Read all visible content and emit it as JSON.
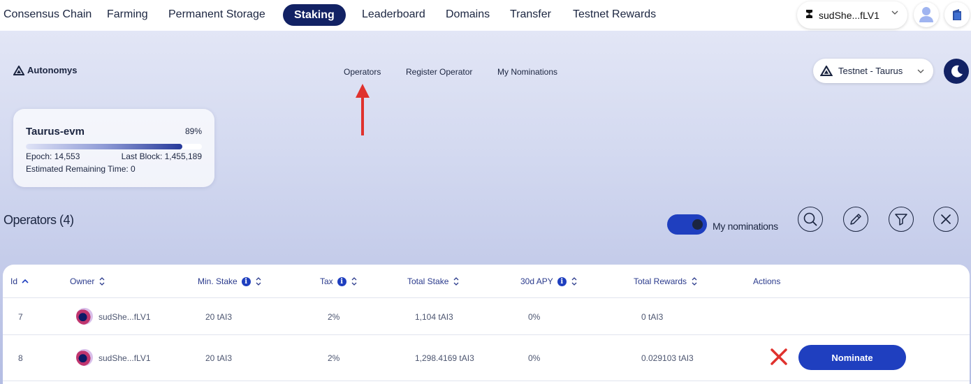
{
  "topnav": {
    "items": [
      {
        "label": "Consensus Chain"
      },
      {
        "label": "Farming"
      },
      {
        "label": "Permanent Storage"
      },
      {
        "label": "Staking",
        "active": true
      },
      {
        "label": "Leaderboard"
      },
      {
        "label": "Domains"
      },
      {
        "label": "Transfer"
      },
      {
        "label": "Testnet Rewards"
      }
    ],
    "wallet_label": "sudShe...fLV1",
    "wallet_icon": "subwallet-logo-icon",
    "profile_icon": "user-icon",
    "extra_icon": "wallet-icon"
  },
  "brand": {
    "name": "Autonomys",
    "icon": "autonomys-logo-icon"
  },
  "subnav": {
    "items": [
      {
        "label": "Operators"
      },
      {
        "label": "Register Operator"
      },
      {
        "label": "My Nominations"
      }
    ]
  },
  "network": {
    "label": "Testnet - Taurus",
    "icon": "autonomys-logo-icon"
  },
  "theme_icon": "moon-icon",
  "annotation_color": "#e0322e",
  "card": {
    "title": "Taurus-evm",
    "progress_pct": 89,
    "progress_label": "89%",
    "epoch_label": "Epoch: 14,553",
    "last_block_label": "Last Block: 1,455,189",
    "remaining_label": "Estimated Remaining Time: 0"
  },
  "operators": {
    "title": "Operators (4)",
    "toggle_label": "My nominations",
    "toggle_on": true,
    "tools": [
      "search-icon",
      "pencil-icon",
      "filter-icon",
      "close-icon"
    ]
  },
  "table": {
    "headers": {
      "id": "Id",
      "owner": "Owner",
      "min_stake": "Min. Stake",
      "tax": "Tax",
      "total_stake": "Total Stake",
      "apy": "30d APY",
      "total_rewards": "Total Rewards",
      "actions": "Actions"
    },
    "rows": [
      {
        "id": "7",
        "owner": "sudShe...fLV1",
        "min_stake": "20 tAI3",
        "tax": "2%",
        "total_stake": "1,104 tAI3",
        "apy": "0%",
        "total_rewards": "0 tAI3",
        "actions": []
      },
      {
        "id": "8",
        "owner": "sudShe...fLV1",
        "min_stake": "20 tAI3",
        "tax": "2%",
        "total_stake": "1,298.4169 tAI3",
        "apy": "0%",
        "total_rewards": "0.029103 tAI3",
        "actions": [
          "Nominate"
        ]
      }
    ]
  },
  "colors": {
    "primary": "#1f3fbf",
    "navy": "#122264",
    "danger": "#e0322e"
  }
}
